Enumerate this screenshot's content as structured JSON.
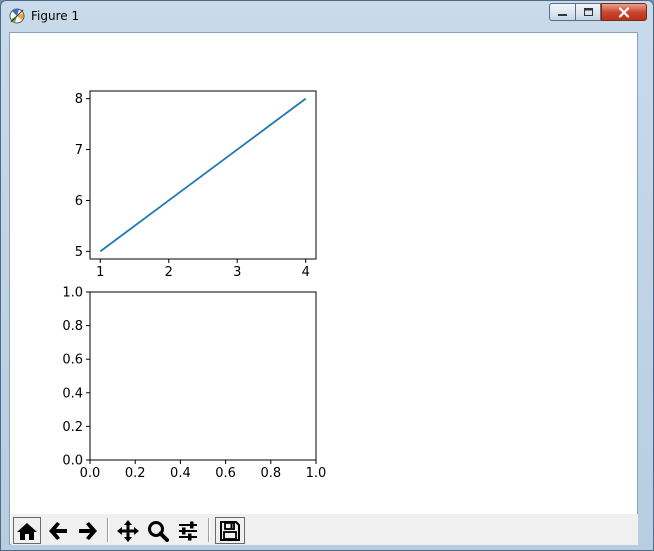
{
  "window": {
    "title": "Figure 1",
    "controls": {
      "minimize": "minimize",
      "maximize": "maximize",
      "close": "close"
    }
  },
  "toolbar": {
    "buttons": [
      {
        "id": "home",
        "icon": "home-icon"
      },
      {
        "id": "back",
        "icon": "arrow-left-icon"
      },
      {
        "id": "forward",
        "icon": "arrow-right-icon"
      },
      {
        "id": "pan",
        "icon": "move-icon"
      },
      {
        "id": "zoom",
        "icon": "zoom-icon"
      },
      {
        "id": "configure",
        "icon": "sliders-icon"
      },
      {
        "id": "save",
        "icon": "save-icon"
      }
    ]
  },
  "colors": {
    "line": "#1f77b4",
    "close_button": "#c8432a"
  },
  "chart_data": [
    {
      "type": "line",
      "series": [
        {
          "x": [
            1,
            2,
            3,
            4
          ],
          "y": [
            5,
            6,
            7,
            8
          ]
        }
      ],
      "xlim": [
        0.85,
        4.15
      ],
      "ylim": [
        4.85,
        8.15
      ],
      "xticks": [
        "1",
        "2",
        "3",
        "4"
      ],
      "yticks": [
        "5",
        "6",
        "7",
        "8"
      ],
      "grid": false
    },
    {
      "type": "line",
      "series": [],
      "xlim": [
        0.0,
        1.0
      ],
      "ylim": [
        0.0,
        1.0
      ],
      "xticks": [
        "0.0",
        "0.2",
        "0.4",
        "0.6",
        "0.8",
        "1.0"
      ],
      "yticks": [
        "0.0",
        "0.2",
        "0.4",
        "0.6",
        "0.8",
        "1.0"
      ],
      "grid": false
    }
  ]
}
